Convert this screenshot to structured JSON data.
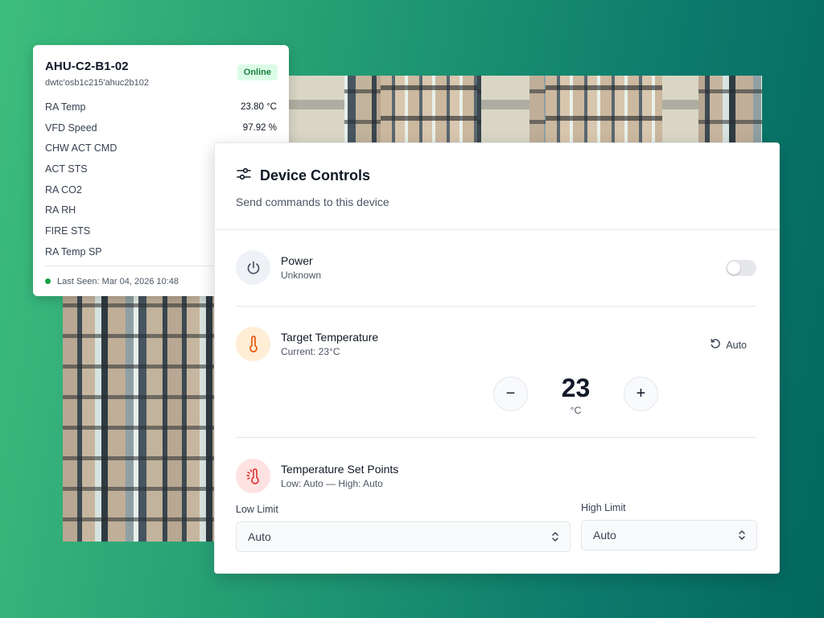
{
  "device": {
    "name": "AHU-C2-B1-02",
    "id": "dwtc'osb1c215'ahuc2b102",
    "status": "Online",
    "metrics": [
      {
        "label": "RA Temp",
        "value": "23.80 °C"
      },
      {
        "label": "VFD Speed",
        "value": "97.92 %"
      },
      {
        "label": "CHW ACT CMD",
        "value": ""
      },
      {
        "label": "ACT STS",
        "value": ""
      },
      {
        "label": "RA CO2",
        "value": ""
      },
      {
        "label": "RA RH",
        "value": ""
      },
      {
        "label": "FIRE STS",
        "value": ""
      },
      {
        "label": "RA Temp SP",
        "value": ""
      }
    ],
    "last_seen": "Last Seen: Mar 04, 2026 10:48"
  },
  "controls": {
    "title": "Device Controls",
    "subtitle": "Send commands to this device",
    "power": {
      "label": "Power",
      "status": "Unknown",
      "enabled": false
    },
    "target_temp": {
      "label": "Target Temperature",
      "current": "Current: 23°C",
      "auto_label": "Auto",
      "value": "23",
      "unit": "°C",
      "decrement": "−",
      "increment": "+"
    },
    "set_points": {
      "label": "Temperature Set Points",
      "summary": "Low: Auto — High: Auto",
      "low_label": "Low Limit",
      "low_value": "Auto",
      "high_label": "High Limit",
      "high_value": "Auto"
    }
  },
  "colors": {
    "online_bg": "#dcfce7",
    "online_text": "#15803d",
    "temp_icon_bg": "#ffedd5",
    "temp_icon": "#ea580c",
    "setpoint_icon_bg": "#fee2e2",
    "setpoint_icon": "#dc2626"
  }
}
